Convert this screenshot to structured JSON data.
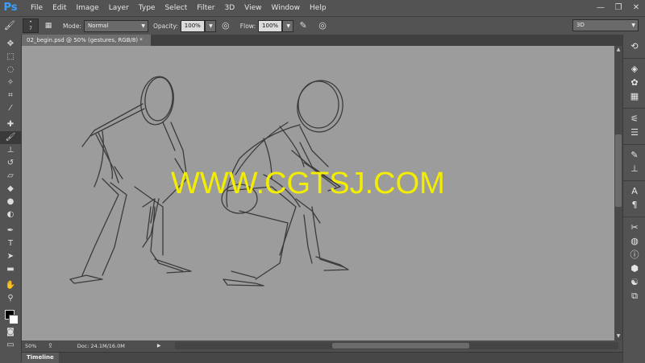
{
  "app": {
    "logo": "Ps"
  },
  "menu": [
    "File",
    "Edit",
    "Image",
    "Layer",
    "Type",
    "Select",
    "Filter",
    "3D",
    "View",
    "Window",
    "Help"
  ],
  "window_controls": [
    "—",
    "❐",
    "✕"
  ],
  "options": {
    "brush_size": "7",
    "mode_label": "Mode:",
    "mode_value": "Normal",
    "opacity_label": "Opacity:",
    "opacity_value": "100%",
    "flow_label": "Flow:",
    "flow_value": "100%",
    "workspace_value": "3D"
  },
  "document": {
    "tab_title": "02_begin.psd @ 50% (gestures, RGB/8) *"
  },
  "watermark": "WWW.CGTSJ.COM",
  "status": {
    "zoom": "50%",
    "doc": "Doc: 24.1M/16.0M"
  },
  "timeline": {
    "label": "Timeline"
  },
  "icons": {
    "tools": [
      "move-icon",
      "marquee-icon",
      "lasso-icon",
      "magic-wand-icon",
      "crop-icon",
      "eyedropper-icon",
      "healing-brush-icon",
      "brush-icon",
      "clone-stamp-icon",
      "history-brush-icon",
      "eraser-icon",
      "gradient-icon",
      "blur-icon",
      "dodge-icon",
      "pen-icon",
      "type-icon",
      "path-select-icon",
      "rectangle-icon",
      "hand-icon",
      "zoom-icon"
    ],
    "panels": [
      "history-icon",
      "layers-icon",
      "color-icon",
      "swatches-icon",
      "adjustments-icon",
      "properties-icon",
      "brush-panel-icon",
      "clone-source-icon",
      "character-icon",
      "paragraph-icon",
      "tools-panel-icon",
      "channels-icon",
      "info-icon",
      "3d-icon",
      "paths-icon",
      "styles-icon"
    ]
  },
  "colors": {
    "canvas": "#9c9c9c",
    "watermark": "#f3ee00",
    "logo": "#3aa0ff"
  }
}
